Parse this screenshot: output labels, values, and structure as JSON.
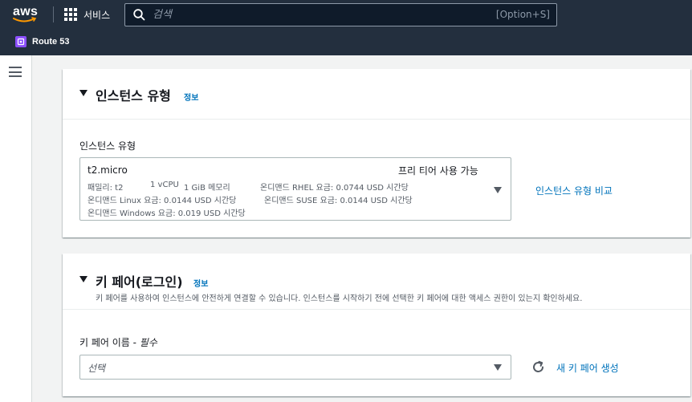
{
  "topbar": {
    "logo_text": "aws",
    "services_label": "서비스",
    "search_placeholder": "검색",
    "search_shortcut": "[Option+S]",
    "service_name": "Route 53",
    "colors": {
      "background": "#232f3e",
      "logo_smile": "#ff9900",
      "route53_icon": "#8c4fff"
    }
  },
  "instance_type_section": {
    "title": "인스턴스 유형",
    "info_label": "정보",
    "field_label": "인스턴스 유형",
    "selected": {
      "name": "t2.micro",
      "free_tier": "프리 티어 사용 가능",
      "family": "패밀리: t2",
      "vcpu": "1 vCPU",
      "memory": "1 GiB 메모리",
      "rhel_price": "온디맨드 RHEL 요금: 0.0744 USD 시간당",
      "linux_price": "온디맨드 Linux 요금: 0.0144 USD 시간당",
      "suse_price": "온디맨드 SUSE 요금: 0.0144 USD 시간당",
      "windows_price": "온디맨드 Windows 요금: 0.019 USD 시간당"
    },
    "compare_link": "인스턴스 유형 비교"
  },
  "keypair_section": {
    "title": "키 페어(로그인)",
    "info_label": "정보",
    "description": "키 페어를 사용하여 인스턴스에 안전하게 연결할 수 있습니다. 인스턴스를 시작하기 전에 선택한 키 페어에 대한 액세스 권한이 있는지 확인하세요.",
    "field_label": "키 페어 이름 - ",
    "required_label": "필수",
    "select_placeholder": "선택",
    "create_link": "새 키 페어 생성"
  },
  "colors": {
    "link": "#0073bb",
    "page_bg": "#f2f3f3",
    "text": "#16191f",
    "muted_text": "#545b64"
  }
}
